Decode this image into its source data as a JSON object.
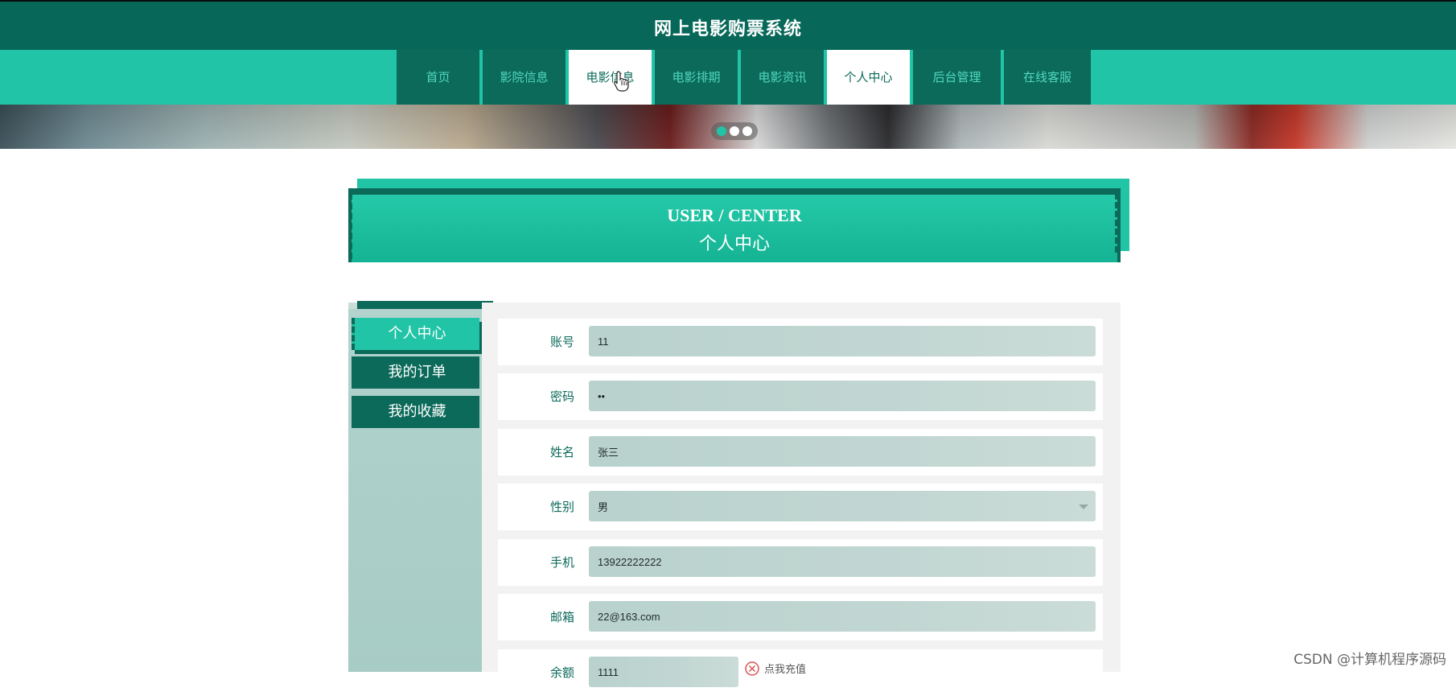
{
  "site": {
    "title": "网上电影购票系统"
  },
  "nav": {
    "items": [
      {
        "label": "首页"
      },
      {
        "label": "影院信息"
      },
      {
        "label": "电影信息"
      },
      {
        "label": "电影排期"
      },
      {
        "label": "电影资讯"
      },
      {
        "label": "个人中心"
      },
      {
        "label": "后台管理"
      },
      {
        "label": "在线客服"
      }
    ],
    "active": "个人中心",
    "hovered": "电影信息"
  },
  "carousel": {
    "slide_count": 3,
    "active_index": 0
  },
  "hero": {
    "title_en": "USER / CENTER",
    "title_cn": "个人中心"
  },
  "sidebar": {
    "items": [
      {
        "label": "个人中心"
      },
      {
        "label": "我的订单"
      },
      {
        "label": "我的收藏"
      }
    ],
    "active": "个人中心"
  },
  "form": {
    "account": {
      "label": "账号",
      "value": "11"
    },
    "password": {
      "label": "密码",
      "value": "••"
    },
    "name": {
      "label": "姓名",
      "value": "张三"
    },
    "gender": {
      "label": "性别",
      "value": "男"
    },
    "phone": {
      "label": "手机",
      "value": "13922222222"
    },
    "email": {
      "label": "邮箱",
      "value": "22@163.com"
    },
    "balance": {
      "label": "余额",
      "value": "1111",
      "action": "点我充值"
    }
  },
  "watermark": "CSDN @计算机程序源码",
  "colors": {
    "primary_dark": "#0b6a5a",
    "primary": "#21c4a6",
    "panel_bg": "#f2f2f2"
  }
}
